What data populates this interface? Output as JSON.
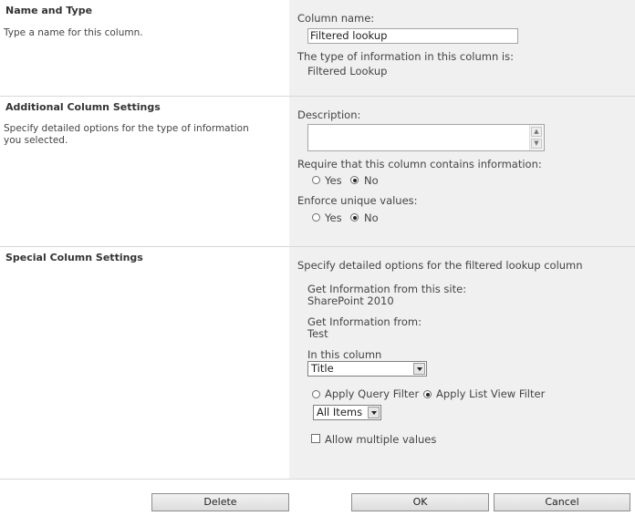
{
  "name_and_type": {
    "title": "Name and Type",
    "description": "Type a name for this column.",
    "column_name_label": "Column name:",
    "column_name_value": "Filtered lookup",
    "type_info_label": "The type of information in this column is:",
    "type_info_value": "Filtered Lookup"
  },
  "additional_settings": {
    "title": "Additional Column Settings",
    "description": "Specify detailed options for the type of information you selected.",
    "description_label": "Description:",
    "description_value": "",
    "require_label": "Require that this column contains information:",
    "require_options": [
      "Yes",
      "No"
    ],
    "require_selected": "No",
    "unique_label": "Enforce unique values:",
    "unique_options": [
      "Yes",
      "No"
    ],
    "unique_selected": "No"
  },
  "special_settings": {
    "title": "Special Column Settings",
    "intro": "Specify detailed options for the filtered lookup column",
    "site_label": "Get Information from this site:",
    "site_value": "SharePoint 2010",
    "from_label": "Get Information from:",
    "from_value": "Test",
    "column_label": "In this column",
    "column_value": "Title",
    "filter_options": [
      "Apply Query Filter",
      "Apply List View Filter"
    ],
    "filter_selected": "Apply List View Filter",
    "view_value": "All Items",
    "allow_multiple_label": "Allow multiple values",
    "allow_multiple_checked": false
  },
  "buttons": {
    "delete": "Delete",
    "ok": "OK",
    "cancel": "Cancel"
  }
}
